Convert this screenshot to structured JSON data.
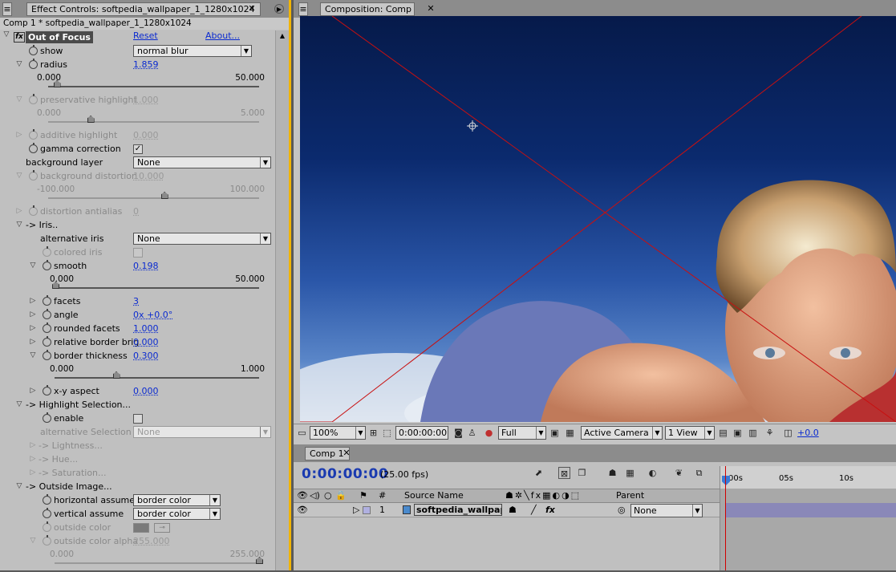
{
  "effect_controls": {
    "tab_title": "Effect Controls: softpedia_wallpaper_1_1280x1024",
    "breadcrumb": "Comp 1 * softpedia_wallpaper_1_1280x1024",
    "effect_name": "Out of Focus",
    "reset": "Reset",
    "about": "About...",
    "fx": "fx",
    "params": {
      "show": {
        "label": "show",
        "value": "normal blur"
      },
      "radius": {
        "label": "radius",
        "value": "1.859",
        "min": "0.000",
        "max": "50.000",
        "level": 0.04
      },
      "preservative_highlight": {
        "label": "preservative highlight",
        "value": "1.000",
        "min": "0.000",
        "max": "5.000",
        "level": 0.2
      },
      "additive_highlight": {
        "label": "additive highlight",
        "value": "0.000"
      },
      "gamma_correction": {
        "label": "gamma correction",
        "checked": true
      },
      "background_layer": {
        "label": "background layer",
        "value": "None"
      },
      "background_distortion": {
        "label": "background distortion",
        "value": "10.000",
        "min": "-100.000",
        "max": "100.000",
        "level": 0.55
      },
      "distortion_antialias": {
        "label": "distortion antialias",
        "value": "0"
      },
      "iris_group": "-> Iris..",
      "alternative_iris": {
        "label": "alternative iris",
        "value": "None"
      },
      "colored_iris": {
        "label": "colored iris",
        "checked": false
      },
      "smooth": {
        "label": "smooth",
        "value": "0.198",
        "min": "0.000",
        "max": "50.000",
        "level": 0.004
      },
      "facets": {
        "label": "facets",
        "value": "3"
      },
      "angle": {
        "label": "angle",
        "value": "0x +0.0°"
      },
      "rounded_facets": {
        "label": "rounded facets",
        "value": "1.000"
      },
      "relative_border": {
        "label": "relative border brig",
        "value": "0.000"
      },
      "border_thickness": {
        "label": "border thickness",
        "value": "0.300",
        "min": "0.000",
        "max": "1.000",
        "level": 0.3
      },
      "xy_aspect": {
        "label": "x-y aspect",
        "value": "0.000"
      },
      "highlight_group": "-> Highlight Selection...",
      "enable": {
        "label": "enable",
        "checked": false
      },
      "alt_selection": {
        "label": "alternative Selection la",
        "value": "None"
      },
      "lightness": "-> Lightness...",
      "hue": "-> Hue...",
      "saturation": "-> Saturation...",
      "outside_group": "-> Outside Image...",
      "horizontal_assume": {
        "label": "horizontal assume",
        "value": "border color"
      },
      "vertical_assume": {
        "label": "vertical assume",
        "value": "border color"
      },
      "outside_color": {
        "label": "outside color",
        "value": "#7a7a7a"
      },
      "outside_color_alpha": {
        "label": "outside color alpha",
        "value": "255.000",
        "min": "0.000",
        "max": "255.000",
        "level": 1.0
      }
    }
  },
  "composition": {
    "tab_title": "Composition: Comp 1",
    "zoom": "100%",
    "timecode": "0:00:00:00",
    "resolution": "Full",
    "camera": "Active Camera",
    "views": "1 View",
    "exposure": "+0.0"
  },
  "timeline": {
    "tab_title": "Comp 1",
    "current_time": "0:00:00:00",
    "fps": "(25.00 fps)",
    "headers": {
      "num": "#",
      "source": "Source Name",
      "parent": "Parent"
    },
    "layer": {
      "num": "1",
      "name": "softpedia_wallpap",
      "parent": "None"
    },
    "ruler_ticks": [
      "00s",
      "05s",
      "10s"
    ]
  }
}
